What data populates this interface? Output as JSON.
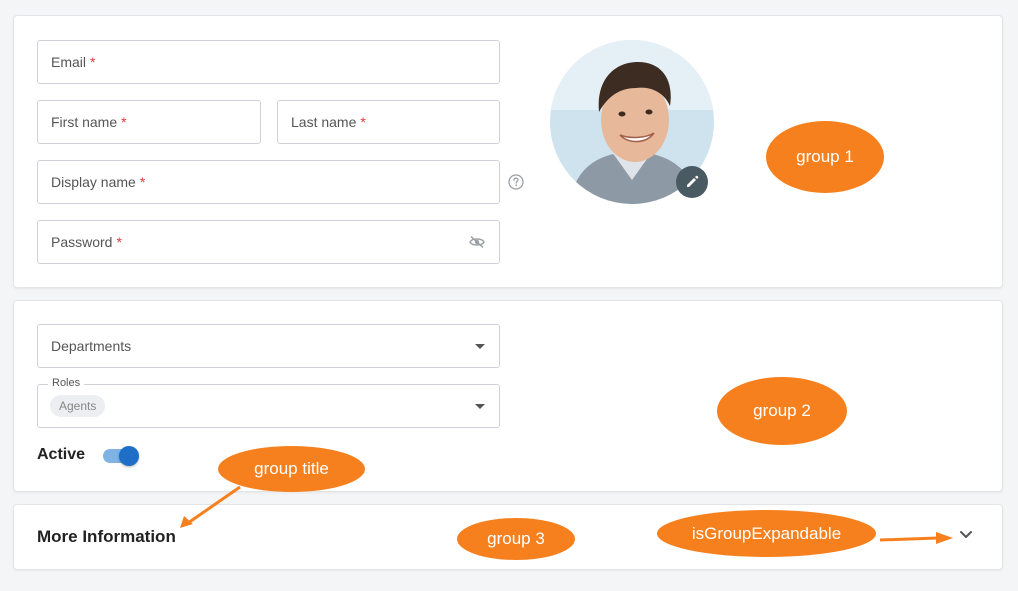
{
  "group1": {
    "email_label": "Email",
    "first_name_label": "First name",
    "last_name_label": "Last name",
    "display_name_label": "Display name",
    "password_label": "Password",
    "required_mark": "*",
    "help_icon": "question-circle-icon",
    "password_icon": "eye-off-icon",
    "edit_icon": "pencil-icon"
  },
  "group2": {
    "departments_label": "Departments",
    "roles_label": "Roles",
    "roles_chip": "Agents",
    "active_label": "Active",
    "active_toggle_on": true
  },
  "group3": {
    "title": "More Information",
    "expand_icon": "chevron-down-icon"
  },
  "annotations": {
    "group1": "group 1",
    "group2": "group 2",
    "group3": "group 3",
    "group_title": "group title",
    "is_group_expandable": "isGroupExpandable",
    "color": "#f7801e"
  },
  "colors": {
    "required": "#e53935",
    "toggle_knob": "#1f6fc9",
    "toggle_track": "#7fb3e5",
    "edit_button": "#4a5a63"
  }
}
